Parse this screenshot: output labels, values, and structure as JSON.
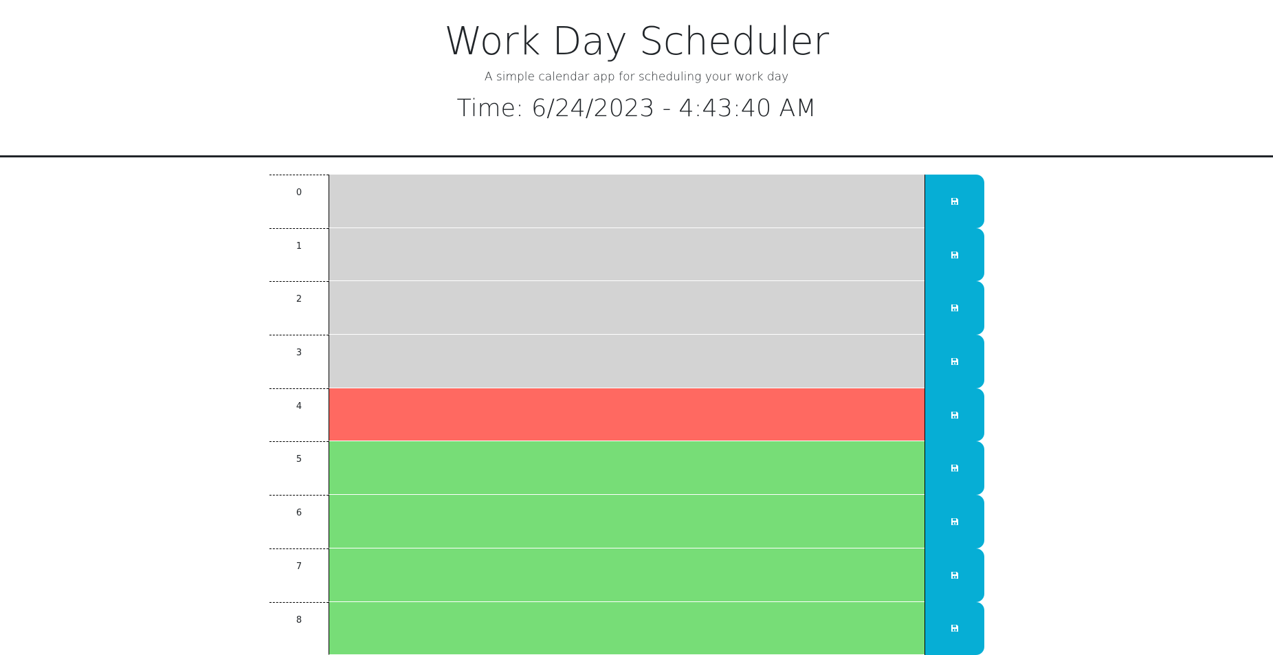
{
  "header": {
    "title": "Work Day Scheduler",
    "subtitle": "A simple calendar app for scheduling your work day",
    "time": "Time: 6/24/2023 - 4:43:40 AM"
  },
  "rows": [
    {
      "hour": "0",
      "status": "past",
      "text": ""
    },
    {
      "hour": "1",
      "status": "past",
      "text": ""
    },
    {
      "hour": "2",
      "status": "past",
      "text": ""
    },
    {
      "hour": "3",
      "status": "past",
      "text": ""
    },
    {
      "hour": "4",
      "status": "present",
      "text": ""
    },
    {
      "hour": "5",
      "status": "future",
      "text": ""
    },
    {
      "hour": "6",
      "status": "future",
      "text": ""
    },
    {
      "hour": "7",
      "status": "future",
      "text": ""
    },
    {
      "hour": "8",
      "status": "future",
      "text": ""
    }
  ],
  "colors": {
    "past": "#d3d3d3",
    "present": "#ff6961",
    "future": "#77dd77",
    "save_button": "#06aed5"
  },
  "icons": {
    "save": "floppy-disk-icon"
  }
}
